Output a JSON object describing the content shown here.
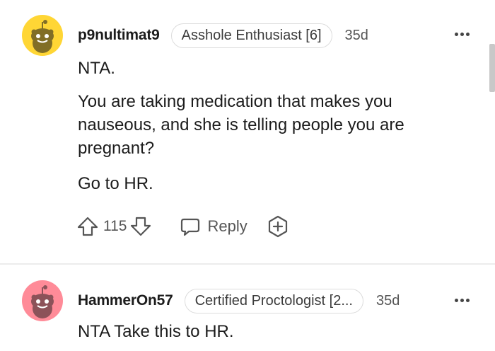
{
  "comments": [
    {
      "username": "p9nultimat9",
      "flair": "Asshole Enthusiast [6]",
      "age": "35d",
      "paragraphs": [
        "NTA.",
        "You are taking medication that makes you nauseous, and she is telling people you are pregnant?",
        "Go to HR."
      ],
      "score": "115",
      "reply_label": "Reply",
      "avatar_color": "#ffd635",
      "icons": [
        "upvote-icon",
        "downvote-icon",
        "reply-icon",
        "award-icon",
        "more-options-icon"
      ]
    },
    {
      "username": "HammerOn57",
      "flair": "Certified Proctologist [2...",
      "age": "35d",
      "paragraphs": [
        "NTA Take this to HR."
      ],
      "avatar_color": "#ff8b98",
      "icons": [
        "more-options-icon"
      ]
    }
  ]
}
